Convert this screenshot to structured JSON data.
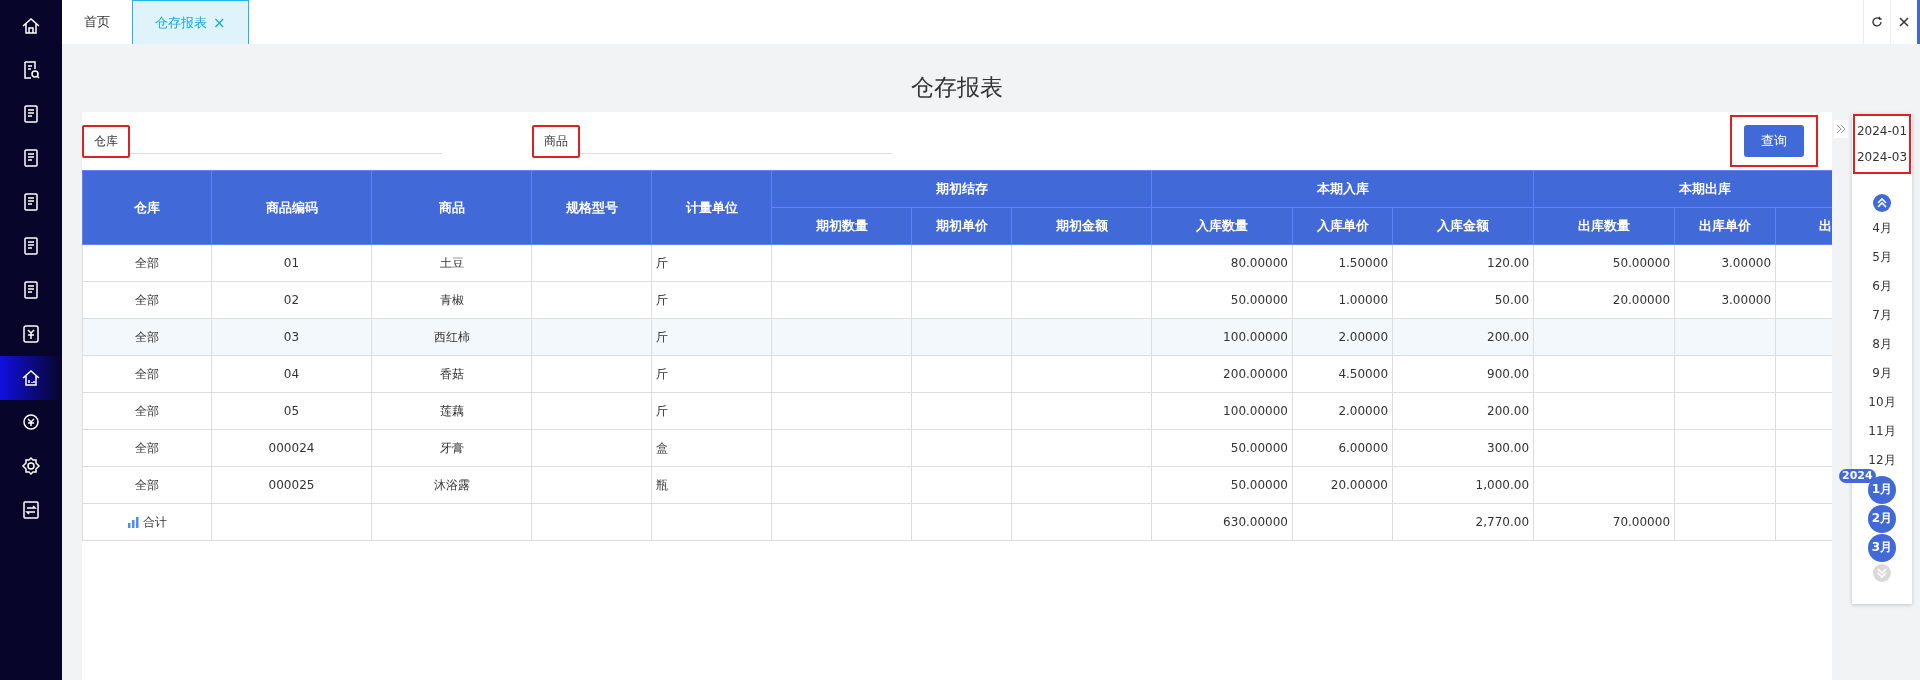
{
  "sidebar": {
    "items": [
      {
        "selected": false
      },
      {
        "selected": false
      },
      {
        "selected": false
      },
      {
        "selected": false
      },
      {
        "selected": false
      },
      {
        "selected": false
      },
      {
        "selected": false
      },
      {
        "selected": false
      },
      {
        "selected": true
      },
      {
        "selected": false
      },
      {
        "selected": false
      },
      {
        "selected": false
      }
    ]
  },
  "tabs": [
    {
      "label": "首页",
      "selected": false
    },
    {
      "label": "仓存报表",
      "selected": true,
      "close": "×"
    }
  ],
  "title": "仓存报表",
  "filters": [
    {
      "label": "仓库",
      "highlighted": true
    },
    {
      "label": "商品",
      "highlighted": true
    }
  ],
  "query_button": {
    "label": "查询",
    "highlighted": true
  },
  "table": {
    "header_rows": [
      [
        {
          "label": "仓库",
          "rowspan": 2
        },
        {
          "label": "商品编码",
          "rowspan": 2
        },
        {
          "label": "商品",
          "rowspan": 2
        },
        {
          "label": "规格型号",
          "rowspan": 2
        },
        {
          "label": "计量单位",
          "rowspan": 2
        },
        {
          "label": "期初结存",
          "colspan": 3
        },
        {
          "label": "本期入库",
          "colspan": 3
        },
        {
          "label": "本期出库",
          "colspan": 3
        }
      ],
      [
        {
          "label": "期初数量"
        },
        {
          "label": "期初单价"
        },
        {
          "label": "期初金额"
        },
        {
          "label": "入库数量"
        },
        {
          "label": "入库单价"
        },
        {
          "label": "入库金额"
        },
        {
          "label": "出库数量"
        },
        {
          "label": "出库单价"
        },
        {
          "label": "出"
        }
      ]
    ],
    "rows": [
      {
        "selected": false,
        "cells": [
          "全部",
          "01",
          "土豆",
          null,
          "斤",
          null,
          null,
          null,
          "80.00000",
          "1.50000",
          "120.00",
          "50.00000",
          "3.00000",
          null
        ]
      },
      {
        "selected": false,
        "cells": [
          "全部",
          "02",
          "青椒",
          null,
          "斤",
          null,
          null,
          null,
          "50.00000",
          "1.00000",
          "50.00",
          "20.00000",
          "3.00000",
          null
        ]
      },
      {
        "selected": true,
        "cells": [
          "全部",
          "03",
          "西红柿",
          null,
          "斤",
          null,
          null,
          null,
          "100.00000",
          "2.00000",
          "200.00",
          null,
          null,
          null
        ]
      },
      {
        "selected": false,
        "cells": [
          "全部",
          "04",
          "香菇",
          null,
          "斤",
          null,
          null,
          null,
          "200.00000",
          "4.50000",
          "900.00",
          null,
          null,
          null
        ]
      },
      {
        "selected": false,
        "cells": [
          "全部",
          "05",
          "莲藕",
          null,
          "斤",
          null,
          null,
          null,
          "100.00000",
          "2.00000",
          "200.00",
          null,
          null,
          null
        ]
      },
      {
        "selected": false,
        "cells": [
          "全部",
          "000024",
          "牙膏",
          null,
          "盒",
          null,
          null,
          null,
          "50.00000",
          "6.00000",
          "300.00",
          null,
          null,
          null
        ]
      },
      {
        "selected": false,
        "cells": [
          "全部",
          "000025",
          "沐浴露",
          null,
          "瓶",
          null,
          null,
          null,
          "50.00000",
          "20.00000",
          "1,000.00",
          null,
          null,
          null
        ]
      }
    ],
    "total": {
      "cells": [
        "合计",
        null,
        null,
        null,
        null,
        null,
        null,
        null,
        "630.00000",
        null,
        "2,770.00",
        "70.00000",
        null,
        null
      ]
    }
  },
  "period": {
    "start": "2024-01",
    "end": "2024-03",
    "highlighted": true
  },
  "months": [
    {
      "label": "4月",
      "selected": false
    },
    {
      "label": "5月",
      "selected": false
    },
    {
      "label": "6月",
      "selected": false
    },
    {
      "label": "7月",
      "selected": false
    },
    {
      "label": "8月",
      "selected": false
    },
    {
      "label": "9月",
      "selected": false
    },
    {
      "label": "10月",
      "selected": false
    },
    {
      "label": "11月",
      "selected": false
    },
    {
      "label": "12月",
      "selected": false
    },
    {
      "label": "1月",
      "selected": true,
      "year": "2024"
    },
    {
      "label": "2月",
      "selected": true
    },
    {
      "label": "3月",
      "selected": true
    }
  ]
}
